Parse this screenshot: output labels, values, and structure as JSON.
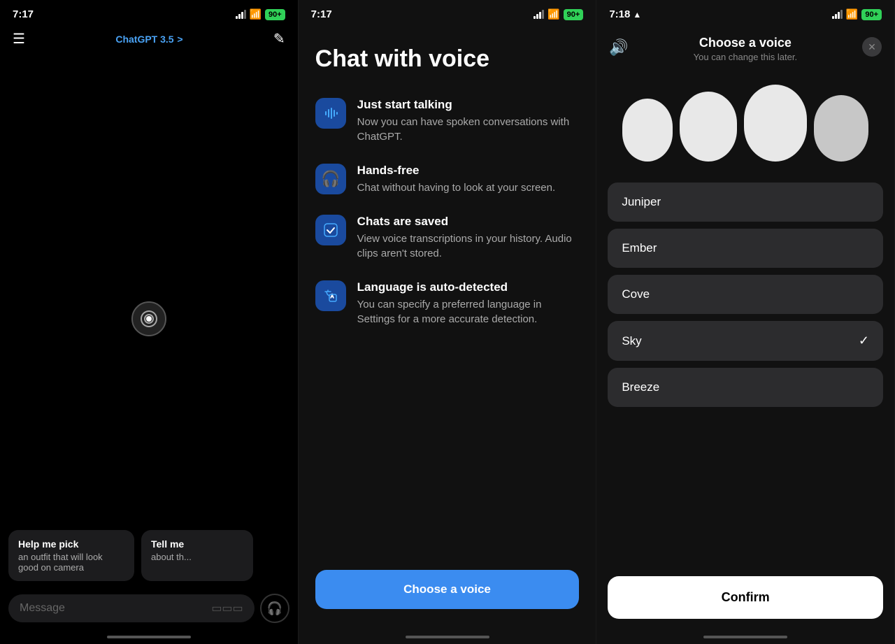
{
  "panel1": {
    "status_time": "7:17",
    "battery": "90+",
    "nav_title": "ChatGPT 3.5",
    "nav_title_arrow": ">",
    "message_placeholder": "Message",
    "chip1_title": "Help me pick",
    "chip1_sub": "an outfit that will look good on camera",
    "chip2_title": "Tell me",
    "chip2_sub": "about th..."
  },
  "panel2": {
    "status_time": "7:17",
    "battery": "90+",
    "main_title": "Chat with voice",
    "features": [
      {
        "icon": "🎵",
        "title": "Just start talking",
        "desc": "Now you can have spoken conversations with ChatGPT."
      },
      {
        "icon": "🎧",
        "title": "Hands-free",
        "desc": "Chat without having to look at your screen."
      },
      {
        "icon": "✔",
        "title": "Chats are saved",
        "desc": "View voice transcriptions in your history. Audio clips aren't stored."
      },
      {
        "icon": "🏳",
        "title": "Language is auto-detected",
        "desc": "You can specify a preferred language in Settings for a more accurate detection."
      }
    ],
    "choose_voice_label": "Choose a voice"
  },
  "panel3": {
    "status_time": "7:18",
    "battery": "90+",
    "header_title": "Choose a voice",
    "header_sub": "You can change this later.",
    "voices": [
      {
        "name": "Juniper",
        "selected": false
      },
      {
        "name": "Ember",
        "selected": false
      },
      {
        "name": "Cove",
        "selected": false
      },
      {
        "name": "Sky",
        "selected": true
      },
      {
        "name": "Breeze",
        "selected": false
      }
    ],
    "confirm_label": "Confirm"
  }
}
